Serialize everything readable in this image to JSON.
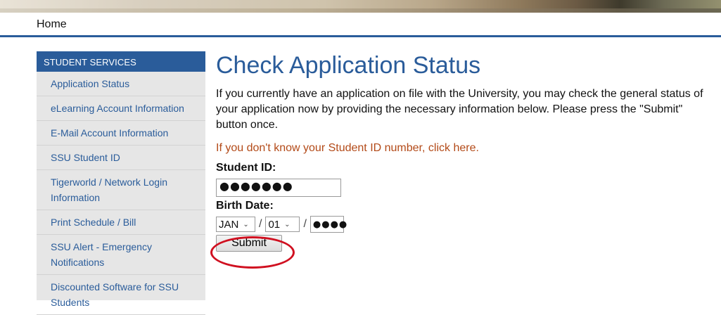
{
  "nav": {
    "home": "Home"
  },
  "sidebar": {
    "heading": "STUDENT SERVICES",
    "items": [
      {
        "label": "Application Status"
      },
      {
        "label": "eLearning Account Information"
      },
      {
        "label": "E-Mail Account Information"
      },
      {
        "label": "SSU Student ID"
      },
      {
        "label": "Tigerworld / Network Login Information"
      },
      {
        "label": "Print Schedule / Bill"
      },
      {
        "label": "SSU Alert - Emergency Notifications"
      },
      {
        "label": "Discounted Software for SSU Students"
      }
    ]
  },
  "main": {
    "title": "Check Application Status",
    "intro": "If you currently have an application on file with the University, you may check the general status of your application now by providing the necessary information below. Please press the \"Submit\" button once.",
    "id_link": "If you don't know your Student ID number, click here.",
    "student_id_label": "Student ID:",
    "student_id_value": "●●●●●●●",
    "birth_date_label": "Birth Date:",
    "month": "JAN",
    "day": "01",
    "separator": "/",
    "year_value": "●●●●",
    "submit_label": "Submit"
  },
  "colors": {
    "accent": "#2a5c9a",
    "link_orange": "#b34a18",
    "highlight_circle": "#d01020"
  }
}
